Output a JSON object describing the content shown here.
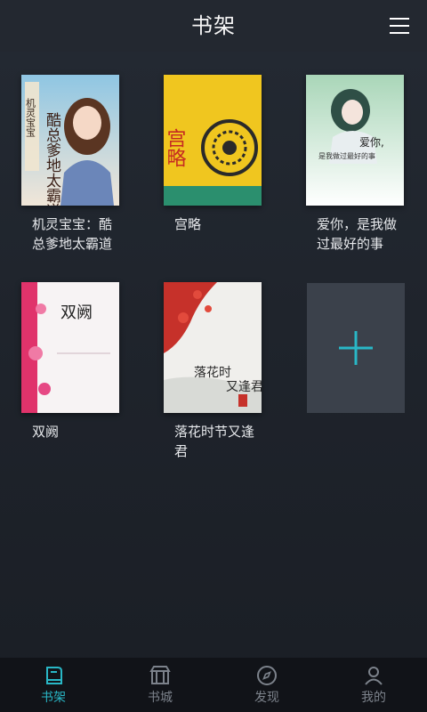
{
  "header": {
    "title": "书架",
    "menu_icon": "menu-icon"
  },
  "shelf": {
    "books": [
      {
        "title": "机灵宝宝：酷总爹地太霸道",
        "cover_text": "机灵宝宝 酷总爹地太霸道"
      },
      {
        "title": "宫略",
        "cover_text": "宫略"
      },
      {
        "title": "爱你，是我做过最好的事",
        "cover_text": "爱你，是我做过最好的事"
      },
      {
        "title": "双阙",
        "cover_text": "双阙"
      },
      {
        "title": "落花时节又逢君",
        "cover_text": "落花时节又逢君"
      }
    ],
    "add_icon": "plus-icon"
  },
  "bottom_nav": {
    "items": [
      {
        "label": "书架",
        "icon": "bookshelf-icon",
        "active": true
      },
      {
        "label": "书城",
        "icon": "store-icon",
        "active": false
      },
      {
        "label": "发现",
        "icon": "compass-icon",
        "active": false
      },
      {
        "label": "我的",
        "icon": "user-icon",
        "active": false
      }
    ]
  },
  "colors": {
    "accent": "#29b7c6",
    "background": "#1e232c",
    "nav_background": "#111318",
    "inactive": "#7c828b"
  }
}
